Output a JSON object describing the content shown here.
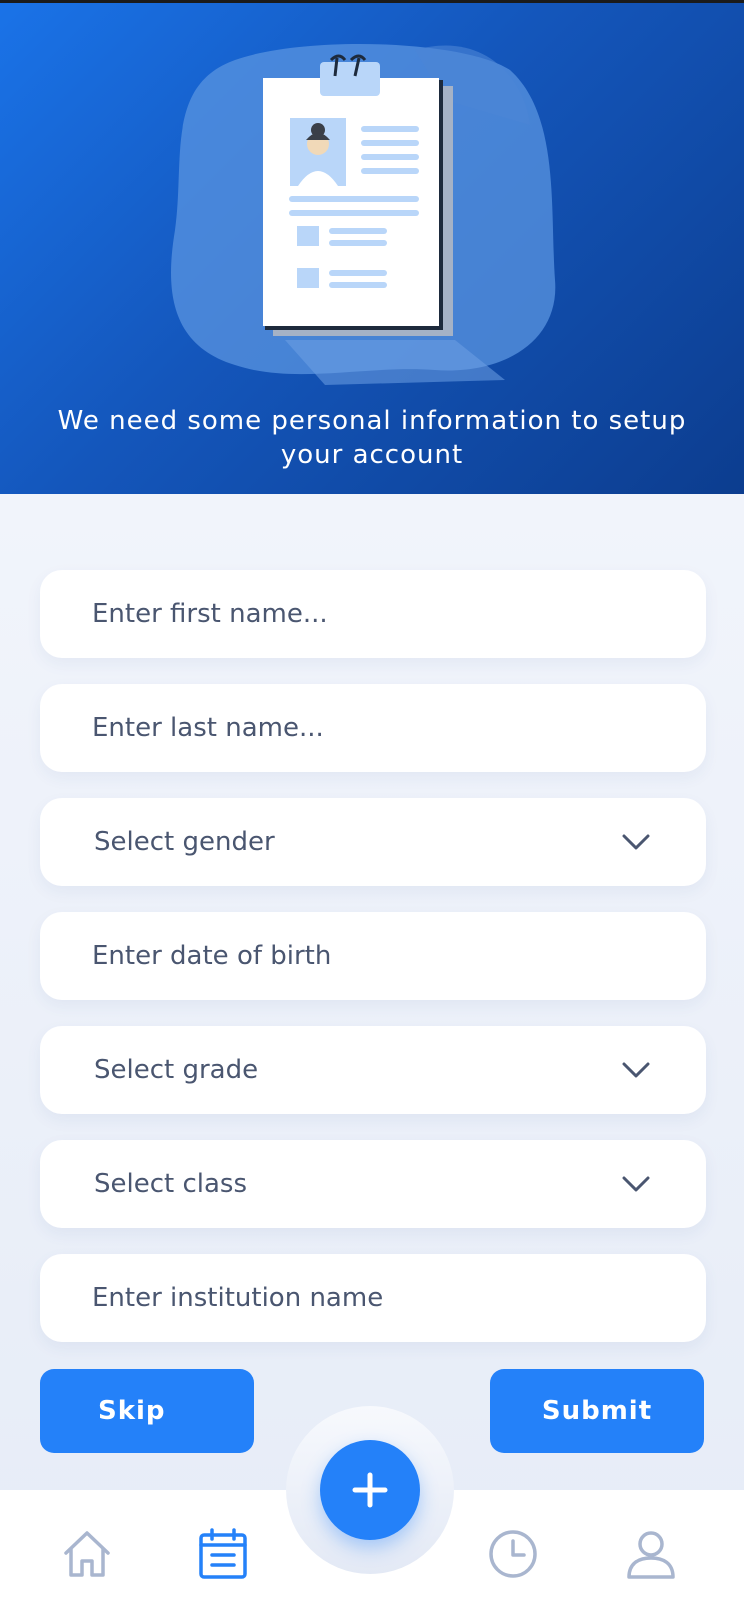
{
  "header": {
    "message": "We need some personal information to setup your account"
  },
  "form": {
    "first_name_placeholder": "Enter first name...",
    "last_name_placeholder": "Enter last name...",
    "gender_label": "Select gender",
    "dob_placeholder": "Enter date of birth",
    "grade_label": "Select grade",
    "class_label": "Select class",
    "institution_placeholder": "Enter institution name"
  },
  "actions": {
    "skip_label": "Skip",
    "submit_label": "Submit"
  },
  "nav": {
    "items": [
      "home-icon",
      "calendar-icon",
      "add-icon",
      "clock-icon",
      "profile-icon"
    ],
    "active": "calendar-icon"
  },
  "colors": {
    "primary": "#2481f9",
    "header_dark": "#0c3d8f",
    "icon_inactive": "#a9b6cf",
    "text": "#4a5670"
  }
}
